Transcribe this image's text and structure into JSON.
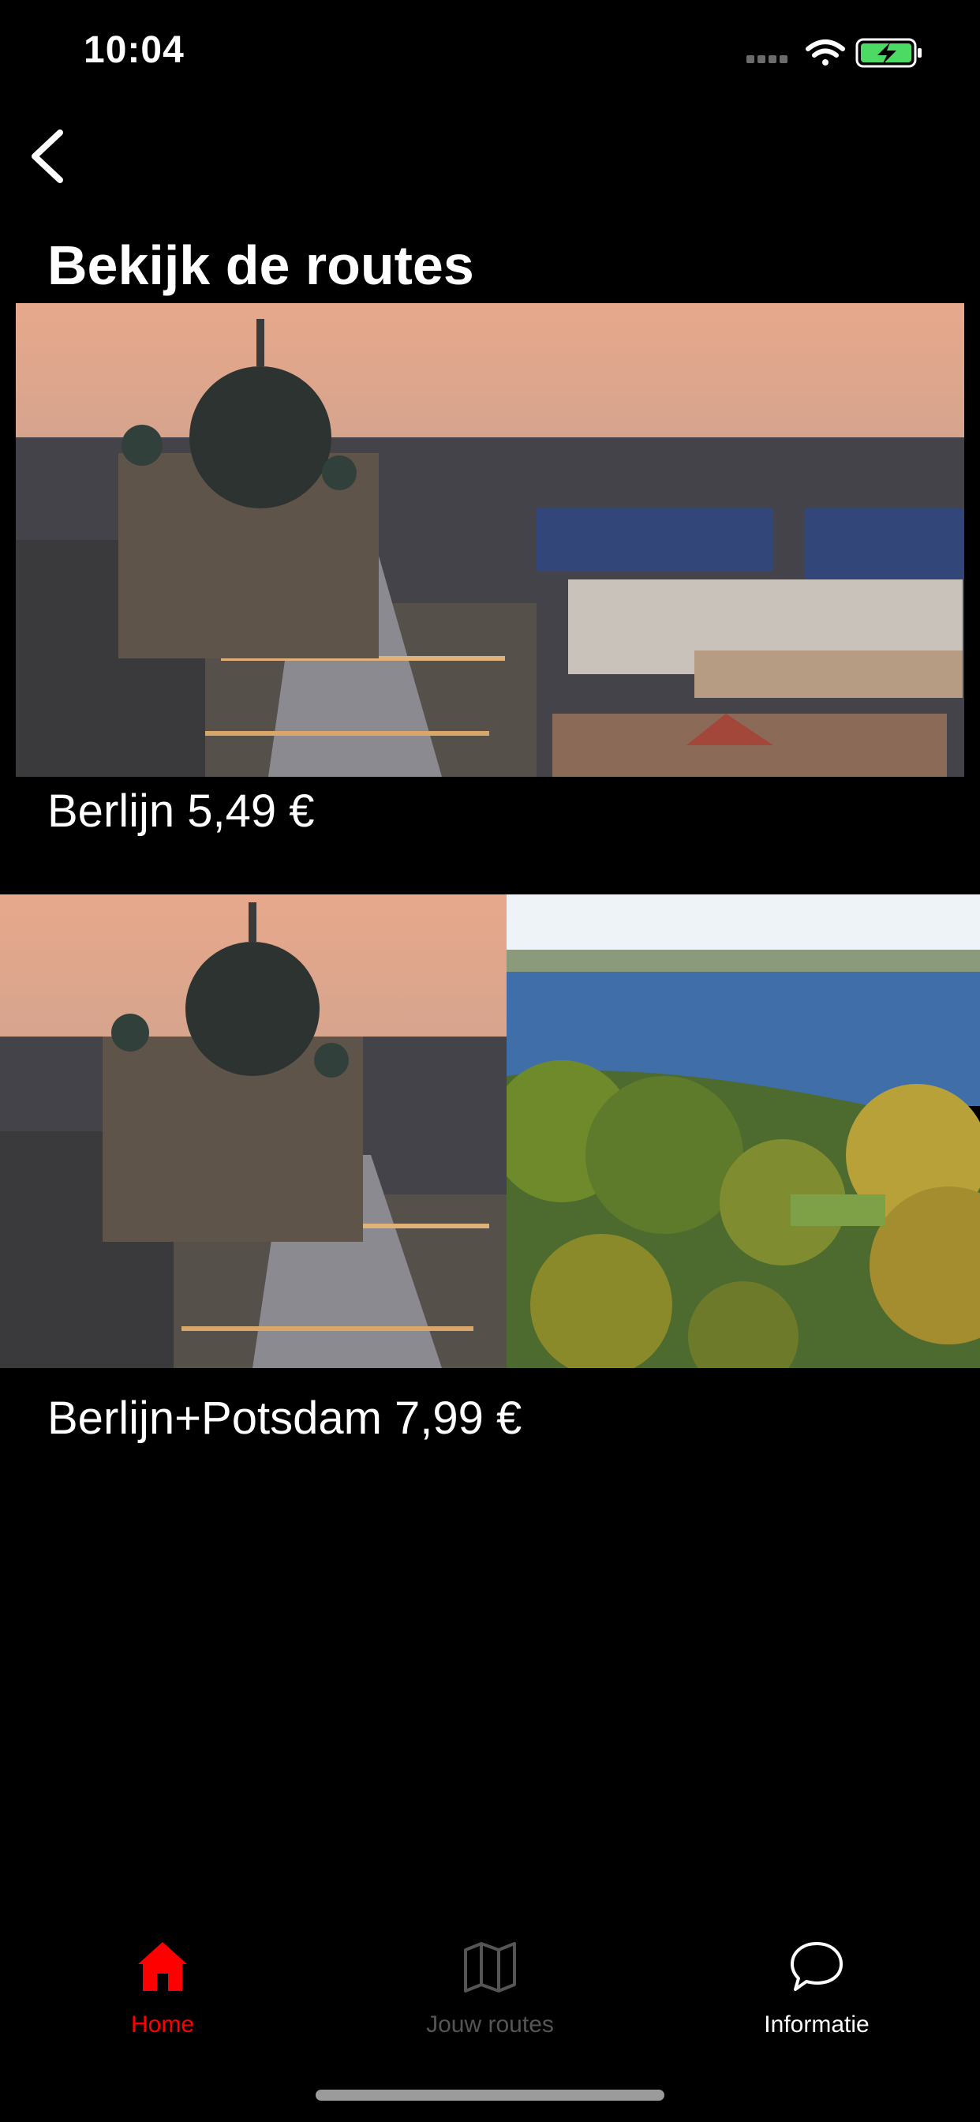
{
  "status_bar": {
    "time": "10:04",
    "battery_color": "#4cd964"
  },
  "nav": {
    "back_icon": "chevron-left-icon"
  },
  "page": {
    "title": "Bekijk de routes"
  },
  "routes": [
    {
      "label": "Berlijn 5,49 €",
      "images": [
        "berlin-cathedral-photo"
      ]
    },
    {
      "label": "Berlijn+Potsdam 7,99 €",
      "images": [
        "berlin-cathedral-photo",
        "potsdam-lake-photo"
      ]
    }
  ],
  "tab_bar": {
    "active_color": "#ff0000",
    "inactive_color": "#555555",
    "items": [
      {
        "label": "Home",
        "icon": "home-icon",
        "state": "active"
      },
      {
        "label": "Jouw routes",
        "icon": "map-icon",
        "state": "disabled"
      },
      {
        "label": "Informatie",
        "icon": "chat-bubble-icon",
        "state": "normal"
      }
    ]
  }
}
